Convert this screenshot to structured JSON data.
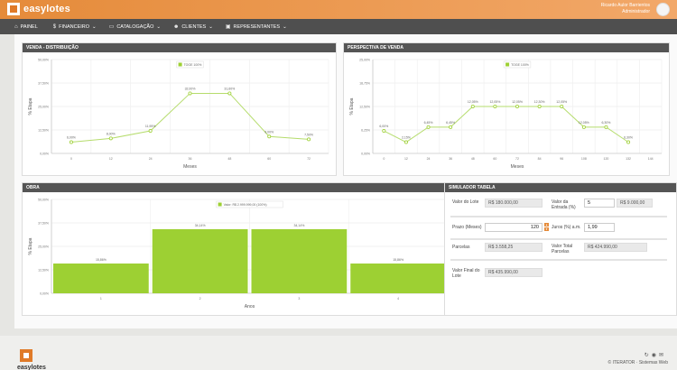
{
  "app": {
    "brand": "easylotes",
    "user_name": "Ricardo Aulor Barrientos",
    "user_role": "Administrador"
  },
  "nav": {
    "items": [
      {
        "icon": "home-icon",
        "glyph": "⌂",
        "label": "PAINEL"
      },
      {
        "icon": "money-icon",
        "glyph": "$",
        "label": "FINANCEIRO"
      },
      {
        "icon": "book-icon",
        "glyph": "▭",
        "label": "CATALOGAÇÃO"
      },
      {
        "icon": "users-icon",
        "glyph": "☻",
        "label": "CLIENTES"
      },
      {
        "icon": "briefcase-icon",
        "glyph": "▣",
        "label": "REPRESENTANTES"
      }
    ]
  },
  "panels": {
    "venda": "VENDA - DISTRIBUIÇÃO",
    "perspectiva": "PERSPECTIVA DE VENDA",
    "obra": "OBRA",
    "simulador": "SIMULADOR TABELA"
  },
  "chart_data": [
    {
      "type": "line",
      "ylabel": "% Etapa",
      "xlabel": "Meses",
      "legend": "TOGE 100%",
      "yticks": [
        "0,00%",
        "12,50%",
        "25,00%",
        "37,50%",
        "50,00%"
      ],
      "ylim": [
        0,
        50
      ],
      "categories": [
        "0",
        "12",
        "24",
        "36",
        "48",
        "60",
        "72"
      ],
      "values": [
        6.0,
        8.0,
        12.0,
        32.0,
        32.0,
        9.0,
        7.5
      ],
      "labels": [
        "6,00%",
        "8,00%",
        "11,95%",
        "32,00%",
        "31,60%",
        "9,00%",
        "7,50%"
      ]
    },
    {
      "type": "line",
      "ylabel": "% Etapa",
      "xlabel": "Meses",
      "legend": "TOGE 100%",
      "yticks": [
        "0,00%",
        "6,25%",
        "12,50%",
        "18,75%",
        "25,00%"
      ],
      "ylim": [
        0,
        25
      ],
      "categories": [
        "0",
        "12",
        "24",
        "36",
        "48",
        "60",
        "72",
        "84",
        "96",
        "108",
        "120",
        "132",
        "144"
      ],
      "values": [
        6.0,
        3.0,
        7.0,
        7.0,
        12.5,
        12.5,
        12.5,
        12.5,
        12.5,
        7.0,
        7.0,
        3.0
      ],
      "labels": [
        "6,00%",
        "2,15%",
        "6,45%",
        "6,45%",
        "12,05%",
        "12,05%",
        "12,05%",
        "12,30%",
        "12,05%",
        "12,05%",
        "6,30%",
        "6,30%",
        "3,14%"
      ]
    },
    {
      "type": "bar",
      "ylabel": "% Etapa",
      "xlabel": "Anos",
      "legend": "Valor: R$ 2.999.999,00 (100%)",
      "yticks": [
        "0,00%",
        "12,50%",
        "25,00%",
        "37,50%",
        "50,00%"
      ],
      "ylim": [
        0,
        50
      ],
      "categories": [
        "1",
        "2",
        "3",
        "4"
      ],
      "values": [
        15.86,
        34.14,
        34.14,
        15.86
      ],
      "labels": [
        "15,86%",
        "34,14%",
        "34,14%",
        "15,86%"
      ]
    }
  ],
  "simulador": {
    "valor_lote_label": "Valor do Lote",
    "valor_lote": "R$ 180.000,00",
    "valor_entrada_label": "Valor da Entrada (%)",
    "valor_entrada_pct": "5",
    "valor_entrada": "R$ 9.000,00",
    "prazo_label": "Prazo (Meses)",
    "prazo": "120",
    "juros_label": "Juros (%) a.m.",
    "juros": "1,99",
    "parcelas_label": "Parcelas",
    "parcelas": "R$ 3.558,25",
    "valor_total_label": "Valor Total Parcelas",
    "valor_total": "R$ 424.990,00",
    "valor_final_label": "Valor Final do Lote",
    "valor_final": "R$ 435.990,00"
  },
  "footer": {
    "copyright": "© ITERATOR · Sistemas Web",
    "brand": "easylotes"
  }
}
